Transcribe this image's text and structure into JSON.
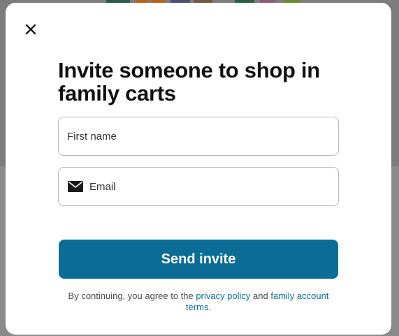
{
  "modal": {
    "title": "Invite someone to shop in family carts",
    "first_name": {
      "placeholder": "First name",
      "value": ""
    },
    "email": {
      "placeholder": "Email",
      "value": "",
      "icon": "mail-icon"
    },
    "send_label": "Send invite",
    "legal": {
      "prefix": "By continuing, you agree to the",
      "privacy_link": "privacy policy",
      "connector": "and",
      "terms_link": "family account terms",
      "suffix": "."
    },
    "close_icon": "close-icon"
  },
  "colors": {
    "accent": "#0b6d96",
    "title": "#111111",
    "field_border": "#b9b9b9",
    "backdrop": "#8a8a8a"
  }
}
